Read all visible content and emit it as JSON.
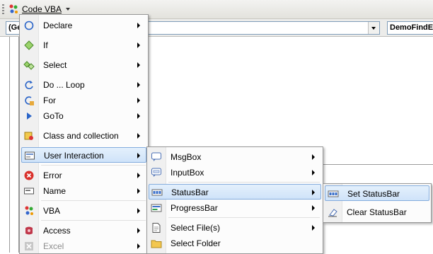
{
  "toolbar": {
    "menu_label": "Code VBA",
    "icon": "vba-addin-icon"
  },
  "codebar": {
    "left_combo": "(Ge",
    "right_combo": "DemoFindE"
  },
  "main_menu": {
    "items": [
      {
        "label": "Declare",
        "icon": "circle-icon"
      },
      {
        "label": "If",
        "icon": "diamond-icon"
      },
      {
        "label": "Select",
        "icon": "select-diamonds-icon"
      },
      {
        "label": "Do ... Loop",
        "icon": "loop-icon"
      },
      {
        "label": "For",
        "icon": "for-loop-icon"
      },
      {
        "label": "GoTo",
        "icon": "goto-arrow-icon"
      },
      {
        "label": "Class and collection",
        "icon": "class-icon"
      },
      {
        "label": "User Interaction",
        "icon": "form-icon"
      },
      {
        "label": "Error",
        "icon": "error-icon"
      },
      {
        "label": "Name",
        "icon": "name-tag-icon"
      },
      {
        "label": "VBA",
        "icon": "vba-icon"
      },
      {
        "label": "Access",
        "icon": "access-icon"
      },
      {
        "label": "Excel",
        "icon": "excel-icon"
      }
    ]
  },
  "ui_menu": {
    "items": [
      {
        "label": "MsgBox",
        "icon": "speech-bubble-icon"
      },
      {
        "label": "InputBox",
        "icon": "input-bubble-icon"
      },
      {
        "label": "StatusBar",
        "icon": "statusbar-icon"
      },
      {
        "label": "ProgressBar",
        "icon": "progressbar-icon"
      },
      {
        "label": "Select File(s)",
        "icon": "file-icon"
      },
      {
        "label": "Select Folder",
        "icon": "folder-icon"
      }
    ]
  },
  "statusbar_menu": {
    "items": [
      {
        "label": "Set StatusBar",
        "icon": "statusbar-icon"
      },
      {
        "label": "Clear StatusBar",
        "icon": "eraser-icon"
      }
    ]
  }
}
